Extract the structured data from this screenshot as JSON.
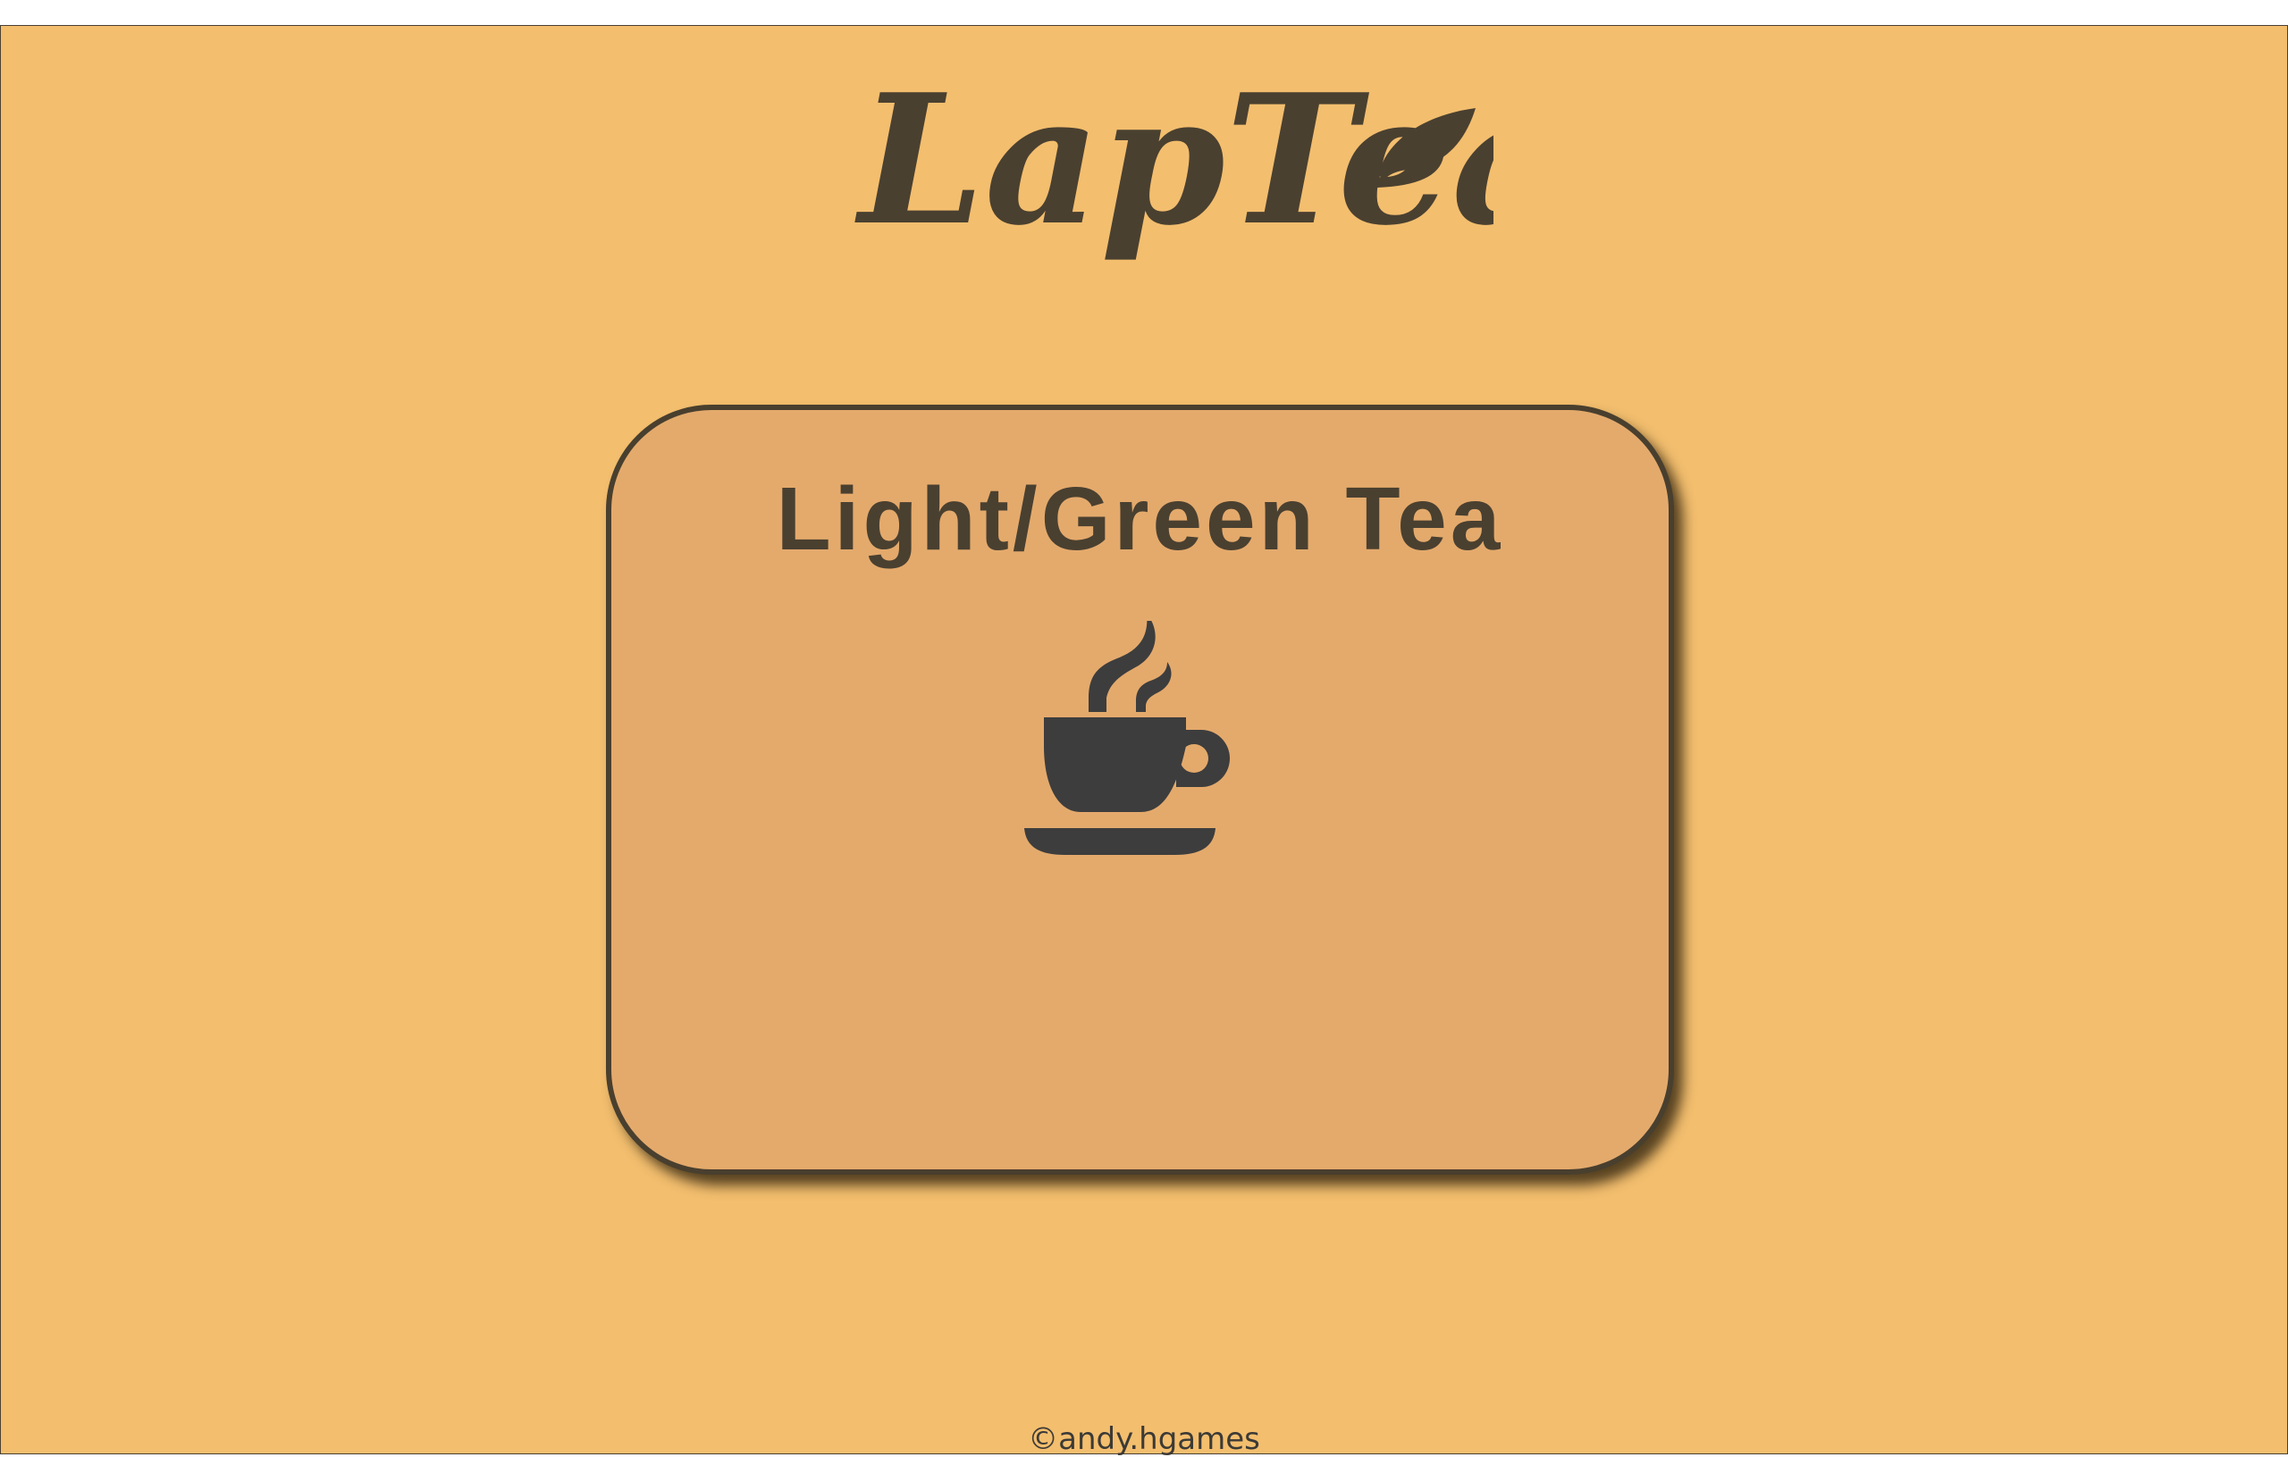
{
  "app": {
    "logo_text": "LapTea"
  },
  "card": {
    "title": "Light/Green Tea",
    "icon": "tea-cup-icon"
  },
  "footer": {
    "copyright": "©andy.hgames"
  },
  "colors": {
    "background": "#f3be6e",
    "card_fill": "#e4aa6c",
    "ink": "#4a4030",
    "icon": "#3d3d3d"
  }
}
